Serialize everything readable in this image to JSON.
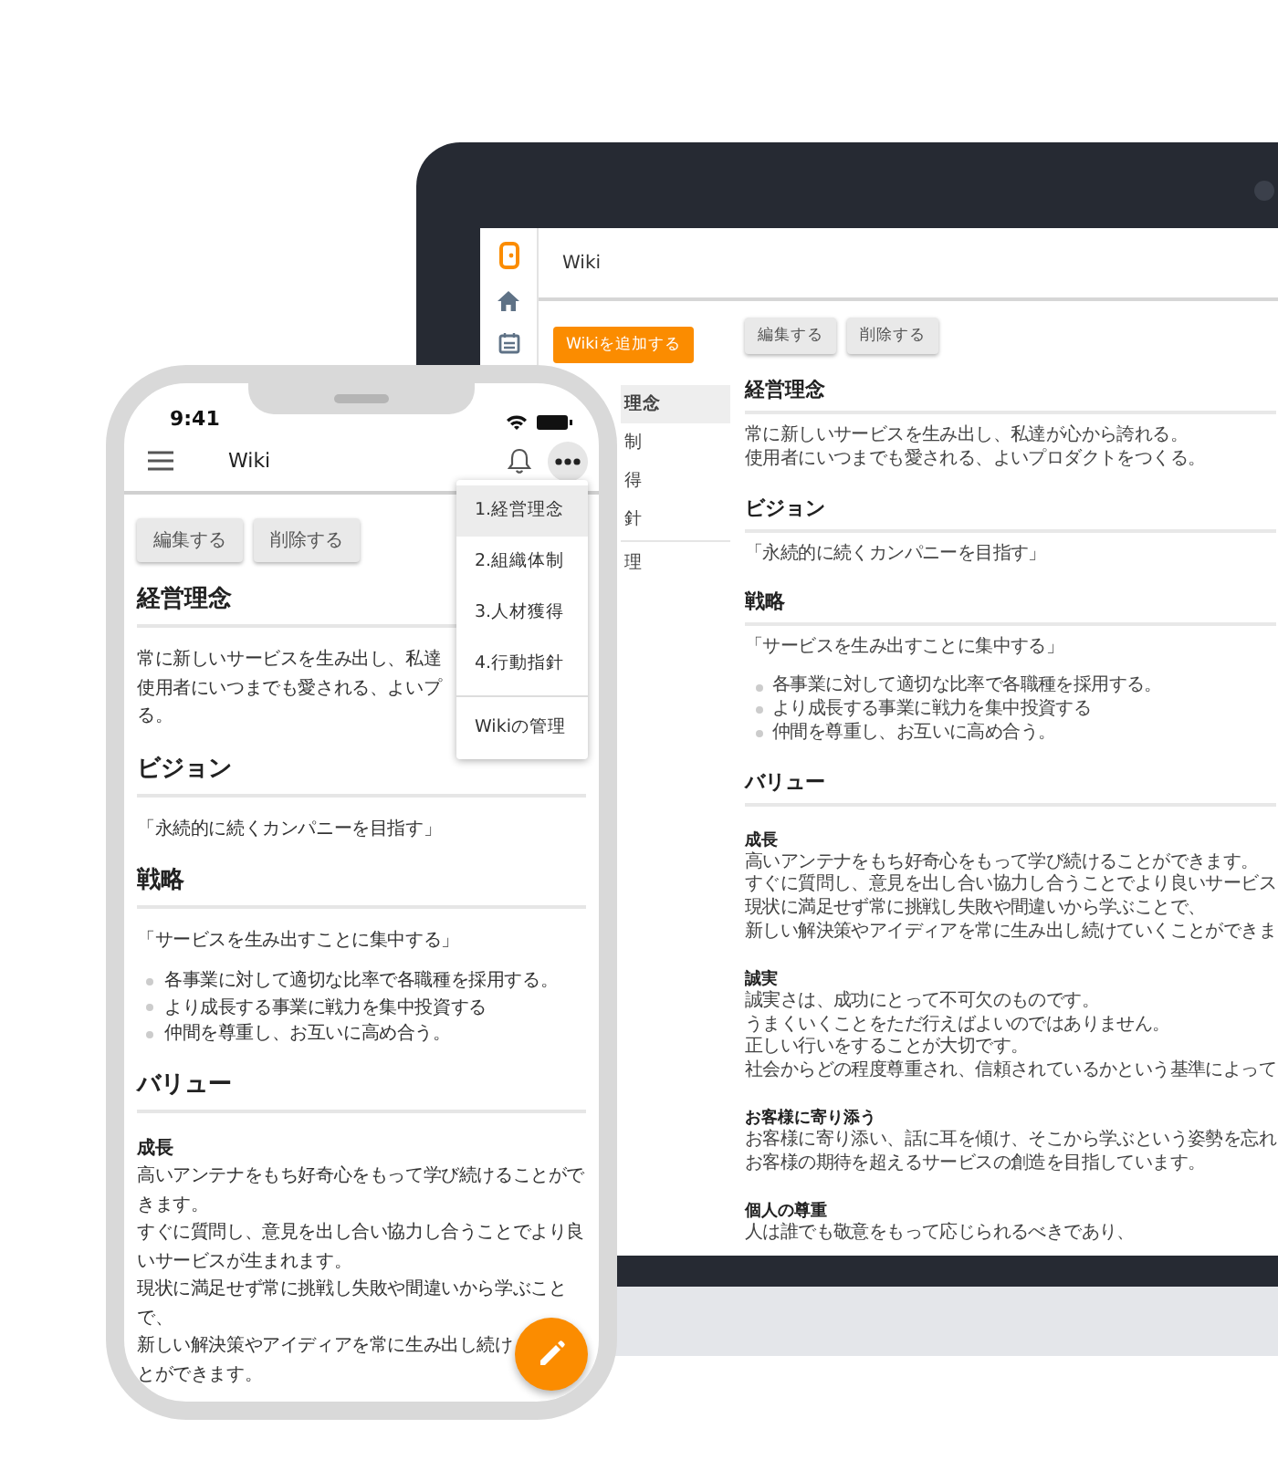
{
  "laptop": {
    "app_title": "Wiki",
    "add_button": "Wikiを追加する",
    "sidebar_items": [
      {
        "label": "理念",
        "selected": true,
        "kind": "link"
      },
      {
        "label": "制",
        "selected": false,
        "kind": "link"
      },
      {
        "label": "得",
        "selected": false,
        "kind": "link"
      },
      {
        "label": "針",
        "selected": false,
        "kind": "link"
      },
      {
        "label": "理",
        "selected": false,
        "kind": "manage"
      }
    ],
    "buttons": [
      "編集する",
      "削除する"
    ],
    "blocks": [
      {
        "kind": "heading",
        "text": "経営理念"
      },
      {
        "kind": "lines",
        "lines": [
          "常に新しいサービスを生み出し、私達が心から誇れる。",
          "使用者にいつまでも愛される、よいプロダクトをつくる。"
        ]
      },
      {
        "kind": "heading",
        "text": "ビジョン"
      },
      {
        "kind": "lines",
        "lines": [
          "「永続的に続くカンパニーを目指す」"
        ]
      },
      {
        "kind": "heading",
        "text": "戦略"
      },
      {
        "kind": "lines",
        "lines": [
          "「サービスを生み出すことに集中する」"
        ]
      },
      {
        "kind": "bullets",
        "items": [
          "各事業に対して適切な比率で各職種を採用する。",
          "より成長する事業に戦力を集中投資する",
          "仲間を尊重し、お互いに高め合う。"
        ]
      },
      {
        "kind": "heading",
        "text": "バリュー"
      },
      {
        "kind": "subheading",
        "text": "成長"
      },
      {
        "kind": "lines",
        "lines": [
          "高いアンテナをもち好奇心をもって学び続けることができます。",
          "すぐに質問し、意見を出し合い協力し合うことでより良いサービス",
          "現状に満足せず常に挑戦し失敗や間違いから学ぶことで、",
          "新しい解決策やアイディアを常に生み出し続けていくことができま"
        ]
      },
      {
        "kind": "subheading",
        "text": "誠実"
      },
      {
        "kind": "lines",
        "lines": [
          "誠実さは、成功にとって不可欠のものです。",
          "うまくいくことをただ行えばよいのではありません。",
          "正しい行いをすることが大切です。",
          "社会からどの程度尊重され、信頼されているかという基準によって"
        ]
      },
      {
        "kind": "subheading",
        "text": "お客様に寄り添う"
      },
      {
        "kind": "lines",
        "lines": [
          "お客様に寄り添い、話に耳を傾け、そこから学ぶという姿勢を忘れ",
          "お客様の期待を超えるサービスの創造を目指しています。"
        ]
      },
      {
        "kind": "subheading",
        "text": "個人の尊重"
      },
      {
        "kind": "lines",
        "lines": [
          "人は誰でも敬意をもって応じられるべきであり、"
        ]
      }
    ]
  },
  "phone": {
    "time": "9:41",
    "app_title": "Wiki",
    "buttons": [
      "編集する",
      "削除する"
    ],
    "menu": [
      {
        "label": "1.経営理念",
        "selected": true,
        "kind": "link"
      },
      {
        "label": "2.組織体制",
        "selected": false,
        "kind": "link"
      },
      {
        "label": "3.人材獲得",
        "selected": false,
        "kind": "link"
      },
      {
        "label": "4.行動指針",
        "selected": false,
        "kind": "link"
      },
      {
        "label": "Wikiの管理",
        "selected": false,
        "kind": "manage"
      }
    ],
    "blocks": [
      {
        "kind": "heading",
        "text": "経営理念"
      },
      {
        "kind": "lines",
        "lines": [
          "常に新しいサービスを生み出し、私達",
          "使用者にいつまでも愛される、よいプ",
          "る。"
        ]
      },
      {
        "kind": "heading",
        "text": "ビジョン"
      },
      {
        "kind": "lines",
        "lines": [
          "「永続的に続くカンパニーを目指す」"
        ]
      },
      {
        "kind": "heading",
        "text": "戦略"
      },
      {
        "kind": "lines",
        "lines": [
          "「サービスを生み出すことに集中する」"
        ]
      },
      {
        "kind": "bullets",
        "items": [
          "各事業に対して適切な比率で各職種を採用する。",
          "より成長する事業に戦力を集中投資する",
          "仲間を尊重し、お互いに高め合う。"
        ]
      },
      {
        "kind": "heading",
        "text": "バリュー"
      },
      {
        "kind": "subheading",
        "text": "成長"
      },
      {
        "kind": "lines",
        "lines": [
          "高いアンテナをもち好奇心をもって学び続けることがで",
          "きます。",
          "すぐに質問し、意見を出し合い協力し合うことでより良",
          "いサービスが生まれます。",
          "現状に満足せず常に挑戦し失敗や間違いから学ぶこと",
          "で、",
          "新しい解決策やアイディアを常に生み出し続け",
          "とができます。"
        ]
      }
    ]
  }
}
